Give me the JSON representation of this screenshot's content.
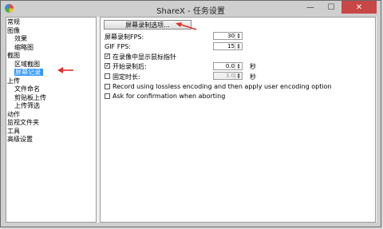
{
  "window": {
    "title": "ShareX - 任务设置",
    "minimize": "—",
    "maximize": "☐",
    "close": "✕"
  },
  "tree": [
    {
      "label": "常规",
      "level": 1
    },
    {
      "label": "图像",
      "level": 1
    },
    {
      "label": "效果",
      "level": 2
    },
    {
      "label": "缩略图",
      "level": 2
    },
    {
      "label": "截图",
      "level": 1
    },
    {
      "label": "区域截图",
      "level": 2
    },
    {
      "label": "屏幕记录",
      "level": 2,
      "selected": true
    },
    {
      "label": "上传",
      "level": 1
    },
    {
      "label": "文件命名",
      "level": 2
    },
    {
      "label": "剪贴板上传",
      "level": 2
    },
    {
      "label": "上传筛选",
      "level": 2
    },
    {
      "label": "动作",
      "level": 1
    },
    {
      "label": "监视文件夹",
      "level": 1
    },
    {
      "label": "工具",
      "level": 1
    },
    {
      "label": "高级设置",
      "level": 1
    }
  ],
  "screen_recording": {
    "options_button": "屏幕录制选项...",
    "fps_label": "屏幕录制FPS:",
    "fps_value": "30",
    "gif_fps_label": "GIF FPS:",
    "gif_fps_value": "15",
    "show_cursor_label": "在录像中显示鼠标指针",
    "show_cursor_checked": true,
    "start_delay_label": "开始录制后:",
    "start_delay_checked": true,
    "start_delay_value": "0.0",
    "start_delay_unit": "秒",
    "fixed_duration_label": "固定时长:",
    "fixed_duration_checked": false,
    "fixed_duration_value": "3.0",
    "fixed_duration_unit": "秒",
    "lossless_label": "Record using lossless encoding and then apply user encoding option",
    "lossless_checked": false,
    "confirm_abort_label": "Ask for confirmation when aborting",
    "confirm_abort_checked": false
  },
  "colors": {
    "selection": "#3399ff",
    "annotation_arrow": "#e0302a"
  }
}
